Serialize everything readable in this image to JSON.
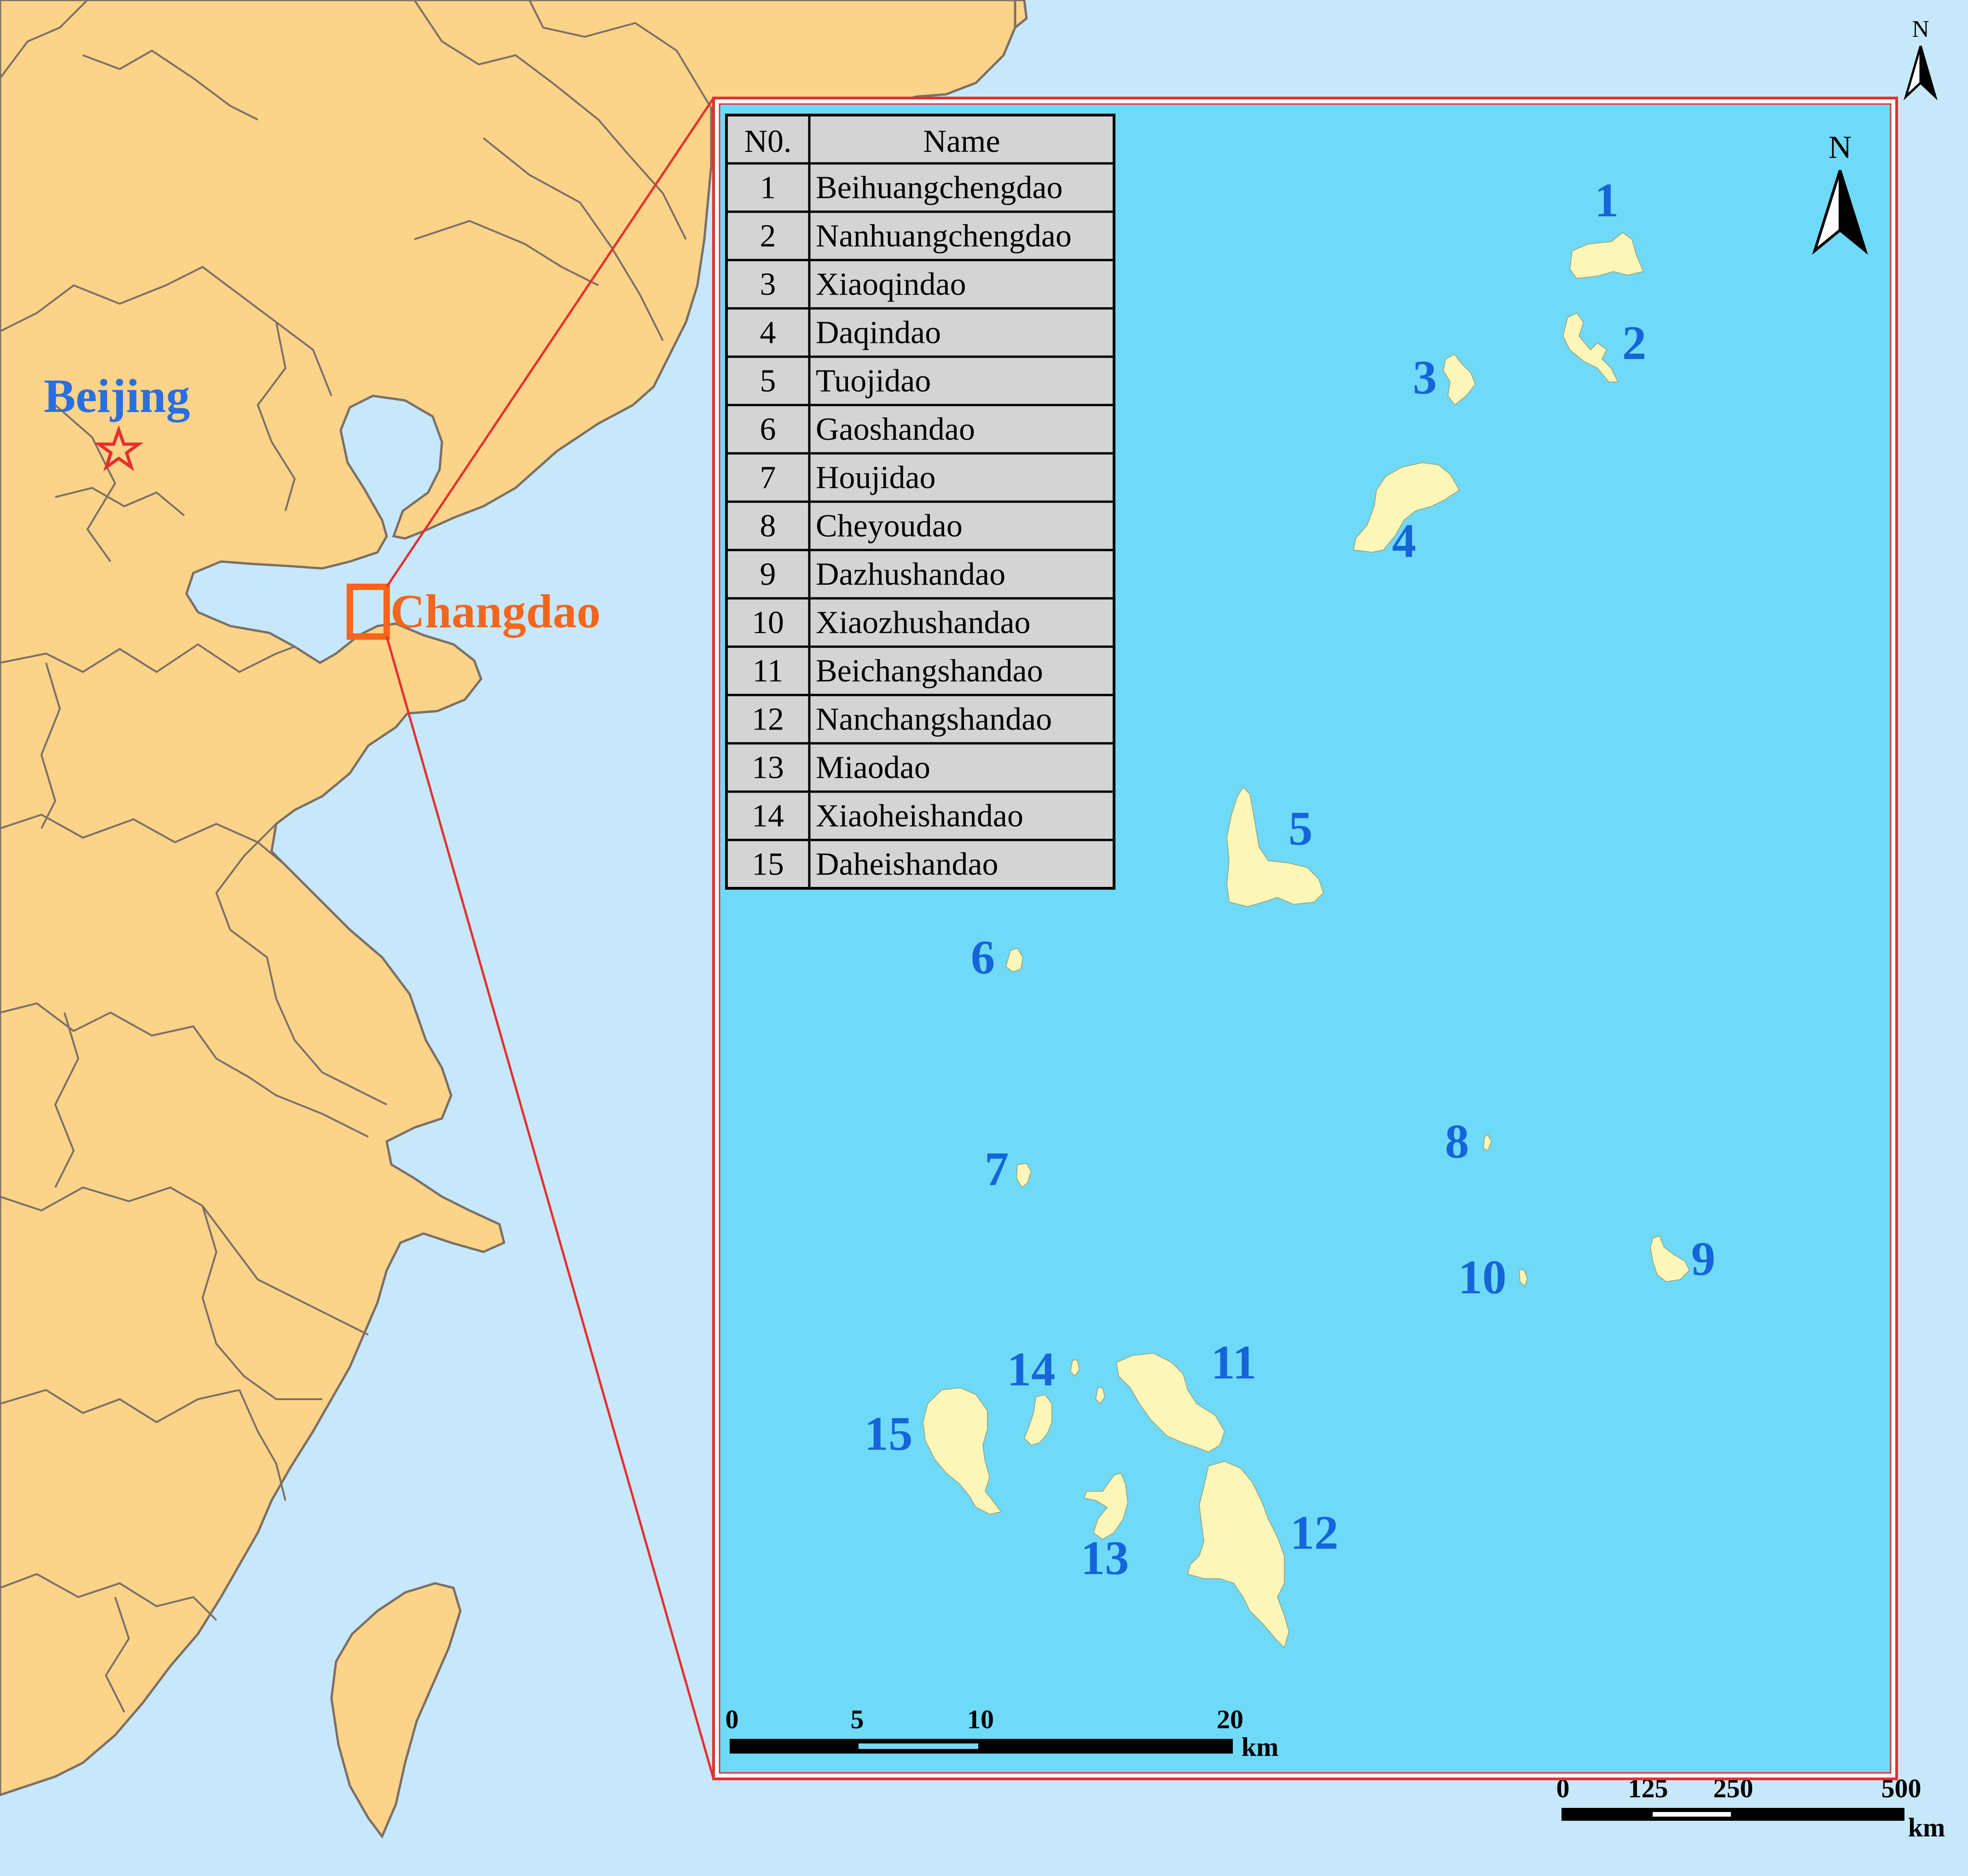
{
  "colors": {
    "sea_outer": "#c7e8fb",
    "sea_inset": "#6fdaf8",
    "land": "#fbd389",
    "island": "#fcf6b8",
    "border": "#7b6f66",
    "inset_frame": "#e53030",
    "label_blue": "#1565d8",
    "changdao_orange": "#f4661d",
    "beijing_blue": "#2a6fe0",
    "star_red": "#e53030",
    "table_fill": "#d4d4d4"
  },
  "main_map": {
    "beijing_label": "Beijing",
    "changdao_label": "Changdao",
    "north_label": "N",
    "scale": {
      "ticks": [
        "0",
        "125",
        "250",
        "500"
      ],
      "unit": "km"
    }
  },
  "inset": {
    "north_label": "N",
    "scale": {
      "ticks": [
        "0",
        "5",
        "10",
        "20"
      ],
      "unit": "km"
    },
    "table": {
      "headers": [
        "N0.",
        "Name"
      ],
      "rows": [
        [
          "1",
          "Beihuangchengdao"
        ],
        [
          "2",
          "Nanhuangchengdao"
        ],
        [
          "3",
          "Xiaoqindao"
        ],
        [
          "4",
          "Daqindao"
        ],
        [
          "5",
          "Tuojidao"
        ],
        [
          "6",
          "Gaoshandao"
        ],
        [
          "7",
          "Houjidao"
        ],
        [
          "8",
          "Cheyoudao"
        ],
        [
          "9",
          "Dazhushandao"
        ],
        [
          "10",
          "Xiaozhushandao"
        ],
        [
          "11",
          "Beichangshandao"
        ],
        [
          "12",
          "Nanchangshandao"
        ],
        [
          "13",
          "Miaodao"
        ],
        [
          "14",
          "Xiaoheishandao"
        ],
        [
          "15",
          "Daheishandao"
        ]
      ]
    },
    "island_labels": [
      "1",
      "2",
      "3",
      "4",
      "5",
      "6",
      "7",
      "8",
      "9",
      "10",
      "11",
      "12",
      "13",
      "14",
      "15"
    ]
  }
}
